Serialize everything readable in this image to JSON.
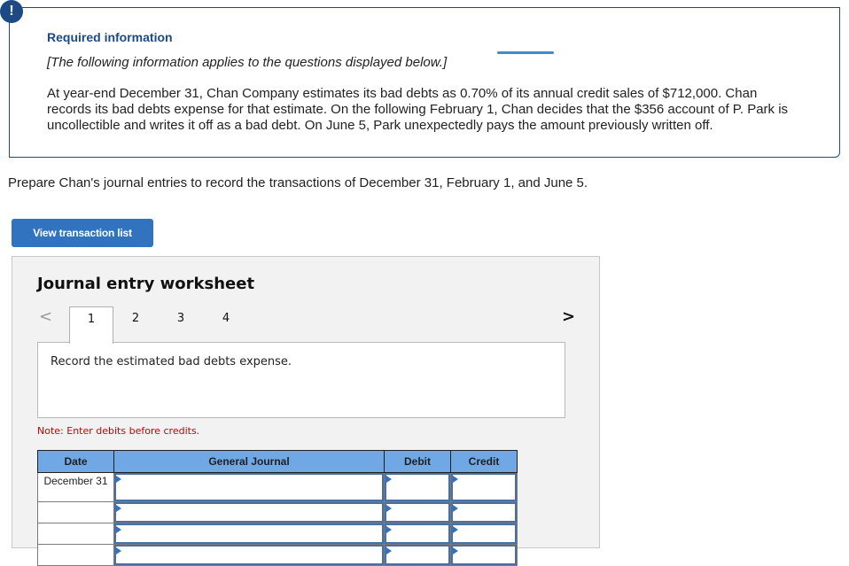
{
  "required_info": {
    "badge": "!",
    "title": "Required information",
    "subtitle": "[The following information applies to the questions displayed below.]",
    "body": "At year-end December 31, Chan Company estimates its bad debts as 0.70% of its annual credit sales of $712,000. Chan records its bad debts expense for that estimate. On the following February 1, Chan decides that the $356 account of P. Park is uncollectible and writes it off as a bad debt. On June 5, Park unexpectedly pays the amount previously written off."
  },
  "prompt": "Prepare Chan's journal entries to record the transactions of December 31, February 1, and June 5.",
  "view_button": "View transaction list",
  "worksheet": {
    "title": "Journal entry worksheet",
    "prev_icon": "<",
    "next_icon": ">",
    "tabs": [
      {
        "label": "1",
        "active": true
      },
      {
        "label": "2",
        "active": false
      },
      {
        "label": "3",
        "active": false
      },
      {
        "label": "4",
        "active": false
      }
    ],
    "instruction": "Record the estimated bad debts expense.",
    "note": "Note: Enter debits before credits.",
    "table": {
      "headers": [
        "Date",
        "General Journal",
        "Debit",
        "Credit"
      ],
      "rows": [
        {
          "date": "December 31",
          "account": "",
          "debit": "",
          "credit": ""
        },
        {
          "date": "",
          "account": "",
          "debit": "",
          "credit": ""
        },
        {
          "date": "",
          "account": "",
          "debit": "",
          "credit": ""
        },
        {
          "date": "",
          "account": "",
          "debit": "",
          "credit": ""
        }
      ]
    }
  },
  "colors": {
    "brand_navy": "#1d4a85",
    "button_blue": "#3273bf",
    "table_header": "#6fa8e4",
    "note_red": "#cc0000"
  }
}
